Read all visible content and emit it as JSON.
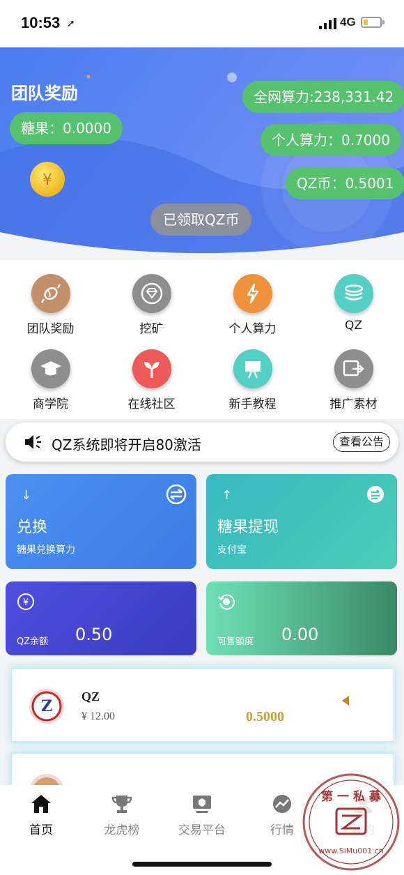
{
  "status": {
    "time": "10:53",
    "network": "4G",
    "battery_level": 0.25
  },
  "hero": {
    "title": "团队奖励",
    "candy": "糖果：0.0000",
    "total_power": "全网算力:238,331.42",
    "personal_power": "个人算力：0.7000",
    "qz_coin": "QZ币：0.5001",
    "claim_button": "已领取QZ币"
  },
  "grid": [
    {
      "label": "团队奖励",
      "icon": "candy-icon",
      "color": "#c4906a"
    },
    {
      "label": "挖矿",
      "icon": "diamond-icon",
      "color": "#8e8e8e"
    },
    {
      "label": "个人算力",
      "icon": "lightning-icon",
      "color": "#f0923b"
    },
    {
      "label": "QZ",
      "icon": "coins-icon",
      "color": "#54cfc4"
    },
    {
      "label": "商学院",
      "icon": "graduation-cap-icon",
      "color": "#8e8e8e"
    },
    {
      "label": "在线社区",
      "icon": "sprout-icon",
      "color": "#ee5a58"
    },
    {
      "label": "新手教程",
      "icon": "easel-icon",
      "color": "#54cfc4"
    },
    {
      "label": "推广素材",
      "icon": "share-screen-icon",
      "color": "#8e8e8e"
    }
  ],
  "notice": {
    "text": "QZ系统即将开启80激活",
    "button": "查看公告"
  },
  "cards": {
    "exchange": {
      "arrow": "↓",
      "title": "兑换",
      "sub": "糖果兑换算力"
    },
    "withdraw": {
      "arrow": "↑",
      "title": "糖果提现",
      "sub": "支付宝"
    },
    "qz_balance": {
      "label": "QZ余额",
      "value": "0.50"
    },
    "sellable": {
      "label": "可售额度",
      "value": "0.00"
    }
  },
  "asset": {
    "name": "QZ",
    "price": "¥ 12.00",
    "amount": "0.5000"
  },
  "tabs": [
    {
      "label": "首页",
      "icon": "home-icon",
      "active": true
    },
    {
      "label": "龙虎榜",
      "icon": "trophy-icon",
      "active": false
    },
    {
      "label": "交易平台",
      "icon": "trade-screen-icon",
      "active": false
    },
    {
      "label": "行情",
      "icon": "trend-chart-icon",
      "active": false
    },
    {
      "label": "我的",
      "icon": "profile-icon",
      "active": false
    }
  ],
  "watermark": {
    "text": "第一私募 www.SiMu001.cn"
  }
}
